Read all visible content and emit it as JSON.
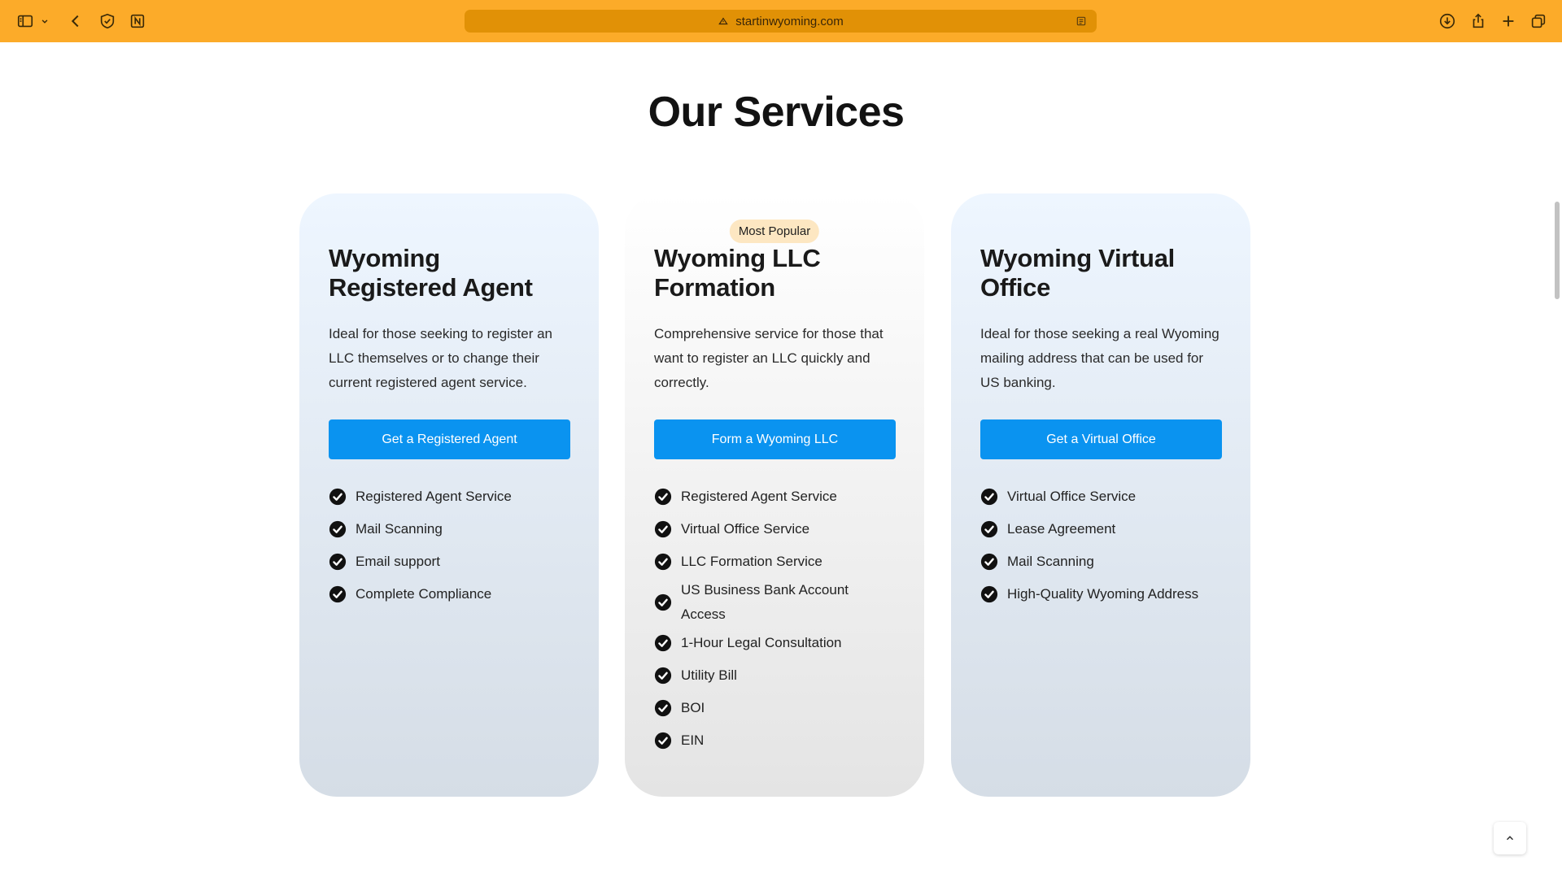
{
  "browser": {
    "url": "startinwyoming.com"
  },
  "heading": "Our Services",
  "cards": [
    {
      "title": "Wyoming Registered Agent",
      "description": "Ideal for those seeking to register an LLC themselves or to change their current registered agent service.",
      "cta": "Get a Registered Agent",
      "features": [
        "Registered Agent Service",
        "Mail Scanning",
        "Email support",
        "Complete Compliance"
      ]
    },
    {
      "badge": "Most Popular",
      "title": "Wyoming LLC Formation",
      "description": "Comprehensive service for those that want to register an LLC quickly and correctly.",
      "cta": "Form a Wyoming LLC",
      "features": [
        "Registered Agent Service",
        "Virtual Office Service",
        "LLC Formation Service",
        "US Business Bank Account Access",
        "1-Hour Legal Consultation",
        "Utility Bill",
        "BOI",
        "EIN"
      ]
    },
    {
      "title": "Wyoming Virtual Office",
      "description": "Ideal for those seeking a real Wyoming mailing address that can be used for US banking.",
      "cta": "Get a Virtual Office",
      "features": [
        "Virtual Office Service",
        "Lease Agreement",
        "Mail Scanning",
        "High-Quality Wyoming Address"
      ]
    }
  ],
  "colors": {
    "browser_bar": "#fcab29",
    "accent": "#0a93f0",
    "badge_bg": "#fde7c2"
  },
  "icons": [
    "sidebar-icon",
    "chevron-down-icon",
    "back-icon",
    "shield-icon",
    "notion-icon",
    "lock-icon",
    "reader-icon",
    "download-icon",
    "share-icon",
    "plus-icon",
    "tabs-icon",
    "check-circle-icon",
    "chevron-up-icon"
  ]
}
